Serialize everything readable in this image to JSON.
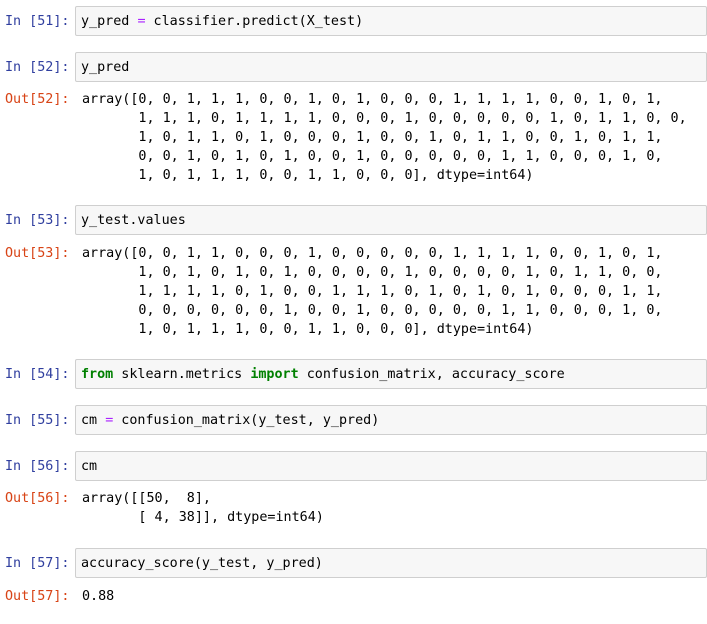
{
  "cells": [
    {
      "in_prompt": "In [51]:",
      "code": {
        "pre": "y_pred ",
        "op": "=",
        "post": " classifier.predict(X_test)"
      }
    },
    {
      "in_prompt": "In [52]:",
      "code": "y_pred",
      "out_prompt": "Out[52]:",
      "output": "array([0, 0, 1, 1, 1, 0, 0, 1, 0, 1, 0, 0, 0, 1, 1, 1, 1, 0, 0, 1, 0, 1,\n       1, 1, 1, 0, 1, 1, 1, 1, 0, 0, 0, 1, 0, 0, 0, 0, 0, 1, 0, 1, 1, 0, 0,\n       1, 0, 1, 1, 0, 1, 0, 0, 0, 1, 0, 0, 1, 0, 1, 1, 0, 0, 1, 0, 1, 1,\n       0, 0, 1, 0, 1, 0, 1, 0, 0, 1, 0, 0, 0, 0, 0, 1, 1, 0, 0, 0, 1, 0,\n       1, 0, 1, 1, 1, 0, 0, 1, 1, 0, 0, 0], dtype=int64)"
    },
    {
      "in_prompt": "In [53]:",
      "code": "y_test.values",
      "out_prompt": "Out[53]:",
      "output": "array([0, 0, 1, 1, 0, 0, 0, 1, 0, 0, 0, 0, 0, 1, 1, 1, 1, 0, 0, 1, 0, 1,\n       1, 0, 1, 0, 1, 0, 1, 0, 0, 0, 0, 1, 0, 0, 0, 0, 1, 0, 1, 1, 0, 0,\n       1, 1, 1, 1, 0, 1, 0, 0, 1, 1, 1, 0, 1, 0, 1, 0, 1, 0, 0, 0, 1, 1,\n       0, 0, 0, 0, 0, 0, 1, 0, 0, 1, 0, 0, 0, 0, 0, 1, 1, 0, 0, 0, 1, 0,\n       1, 0, 1, 1, 1, 0, 0, 1, 1, 0, 0, 0], dtype=int64)"
    },
    {
      "in_prompt": "In [54]:",
      "code": {
        "kw1": "from",
        "mid": " sklearn.metrics ",
        "kw2": "import",
        "post": " confusion_matrix, accuracy_score"
      }
    },
    {
      "in_prompt": "In [55]:",
      "code": {
        "pre": "cm ",
        "op": "=",
        "post": " confusion_matrix(y_test, y_pred)"
      }
    },
    {
      "in_prompt": "In [56]:",
      "code": "cm",
      "out_prompt": "Out[56]:",
      "output": "array([[50,  8],\n       [ 4, 38]], dtype=int64)"
    },
    {
      "in_prompt": "In [57]:",
      "code": "accuracy_score(y_test, y_pred)",
      "out_prompt": "Out[57]:",
      "output": "0.88"
    }
  ]
}
